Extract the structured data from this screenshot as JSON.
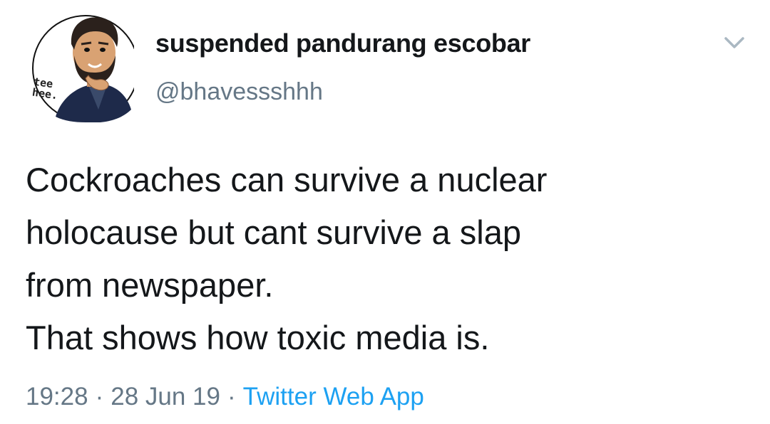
{
  "author": {
    "display_name": "suspended pandurang escobar",
    "handle": "@bhavessshhh",
    "avatar_caption": "tee\nhee.",
    "avatar_icon": "bitmoji-avatar-icon"
  },
  "tweet": {
    "lines": [
      "Cockroaches can survive a nuclear",
      "holocause but cant survive a slap",
      "from newspaper.",
      "That shows how toxic media is."
    ]
  },
  "meta": {
    "time": "19:28",
    "separator_1": "·",
    "date": "28 Jun 19",
    "separator_2": "·",
    "source": "Twitter Web App"
  },
  "colors": {
    "text": "#14171a",
    "secondary": "#657786",
    "link": "#1da1f2",
    "chevron": "#aab8c2"
  },
  "icons": {
    "menu": "chevron-down-icon"
  }
}
